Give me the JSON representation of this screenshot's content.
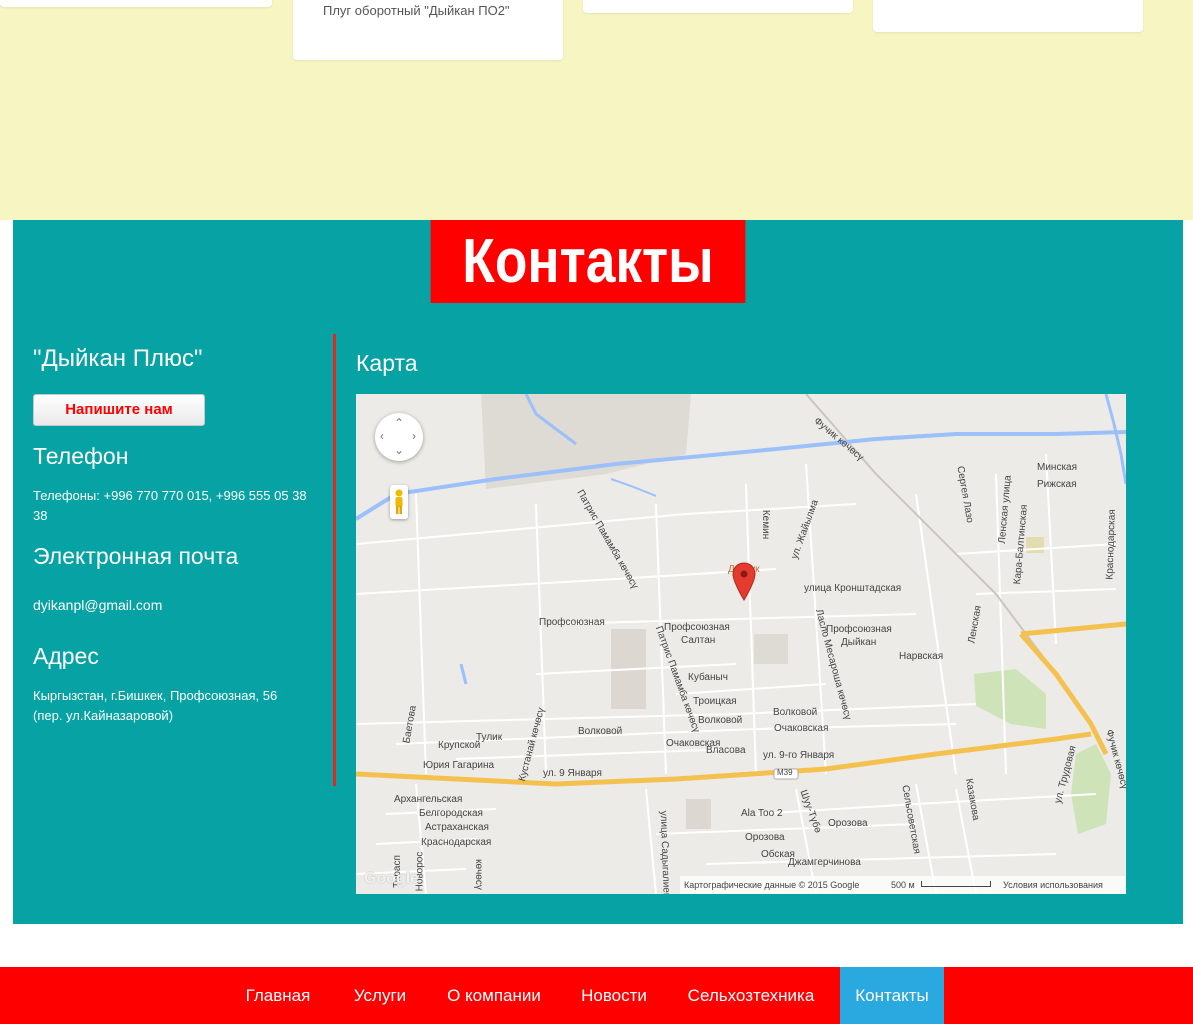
{
  "products": {
    "card2_caption": "Плуг оборотный \"Дыйкан ПО2\""
  },
  "contacts": {
    "title": "Контакты",
    "company_name": "\"Дыйкан Плюс\"",
    "write_us_label": "Напишите нам",
    "phone_heading": "Телефон",
    "phone_text": "Телефоны: +996 770 770 015, +996 555 05 38 38",
    "email_heading": "Электронная почта",
    "email_text": "dyikanpl@gmail.com",
    "address_heading": "Адрес",
    "address_text": "Кыргызстан, г.Бишкек, Профсоюзная, 56 (пер. ул.Кайназаровой)"
  },
  "map": {
    "heading": "Карта",
    "attribution": "Картографические данные © 2015 Google",
    "scale_label": "500 м",
    "terms_label": "Условия использования",
    "logo": "Google",
    "badge": "M39",
    "labels": {
      "minskaya": "Минская",
      "rizhskaya": "Рижская",
      "kemin": "Кемин",
      "zhaiylma": "ул. Жайылма",
      "sergeya_lazo": "Сергея Лазо",
      "lenskaya_top": "Ленская улица",
      "kara_baltinskaya": "Кара-Балтинская",
      "krasnodarskaya_right": "Краснодарская",
      "fuchik_top": "Фучик көчөсү",
      "patris_top": "Патрис Памамба көчөсү",
      "dostuk": "Достук",
      "kronshtadtskaya": "улица Кронштадская",
      "profsoyuznaya_left": "Профсоюзная",
      "profsoyuznaya_mid": "Профсоюзная",
      "saltan": "Салтан",
      "patris_mid": "Патрис Памамба көчөсү",
      "laspo": "Ласло Месароша көчөсү",
      "profsoyuznaya_right": "Профсоюзная",
      "dyikan": "Дыйкан",
      "narvskaya": "Нарвская",
      "lenskaya": "Ленская",
      "kubanych": "Кубаныч",
      "troitskaya": "Троицкая",
      "volkovoy1": "Волковой",
      "volkovoy2": "Волковой",
      "volkovoy3": "Волковой",
      "ochakovskaya1": "Очаковская",
      "ochakovskaya2": "Очаковская",
      "vlasova": "Власова",
      "yanvarya9_right": "ул. 9-го Января",
      "yanvarya9_left": "ул. 9 Января",
      "baetova": "Баетова",
      "krupskoy": "Крупской",
      "tulik": "Тулик",
      "kustanai": "Кустанай көчөсү",
      "gagarina": "Юрия Гагарина",
      "volkovoy_left": "Волковой",
      "arkhangelskaya": "Архангельская",
      "belgorodskaya": "Белгородская",
      "astrakhanskaya": "Астраханская",
      "krasnodarskaya": "Краснодарская",
      "sadygaliev": "улица Садыгалиев",
      "ala_too": "Ala Too 2",
      "shu_tube": "Шуу-Түбө",
      "orozova1": "Орозова",
      "orozova2": "Орозова",
      "obskaya": "Обская",
      "dzhamgerchinova": "Джамгерчинова",
      "selsovetskaya": "Сельсоветская",
      "kazakova": "Казакова",
      "trudovaya": "ул. Трудовая",
      "fuchik_bottom": "Фучик көчөсү",
      "tiraspol": "Тирасп",
      "novoros": "Новорос",
      "kecheu": "көчөсү"
    }
  },
  "nav": {
    "items": [
      "Главная",
      "Услуги",
      "О компании",
      "Новости",
      "Сельхозтехника",
      "Контакты"
    ],
    "active_color": "#2aa8e0",
    "bar_color": "#ff0000"
  }
}
